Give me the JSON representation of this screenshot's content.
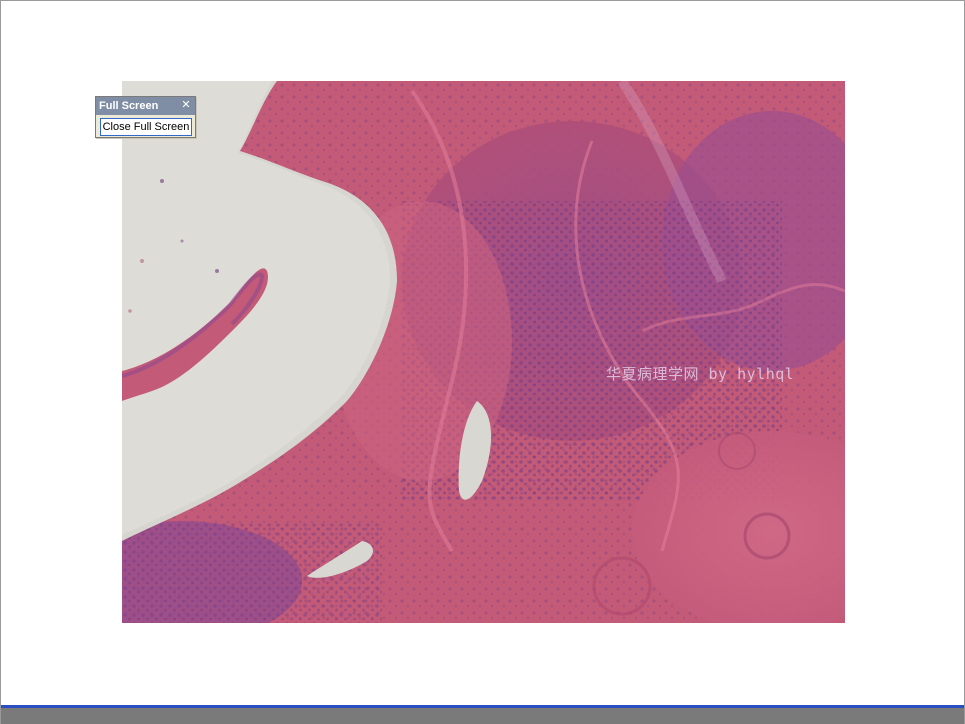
{
  "toolbar": {
    "title": "Full Screen",
    "close_glyph": "✕",
    "close_full_screen_label": "Close Full Screen"
  },
  "image": {
    "watermark": "华夏病理学网 by hylhql"
  },
  "colors": {
    "toolbar_title_bg": "#7f8ea5",
    "toolbar_bg": "#ece9d8",
    "button_border": "#316ac5",
    "bottom_bar_accent": "#2a4fc0",
    "bottom_bar_bg": "#7a7a7a"
  }
}
